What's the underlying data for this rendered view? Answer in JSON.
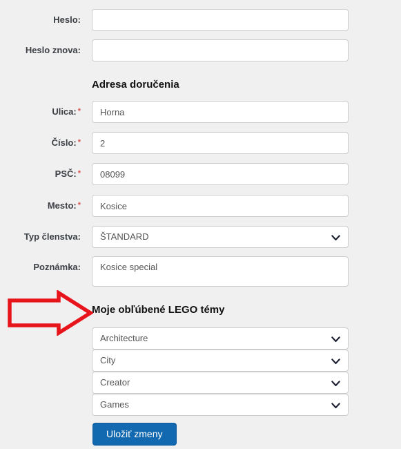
{
  "colors": {
    "page_background": "#f0f0f0",
    "field_border": "#cccccc",
    "field_background": "#ffffff",
    "label_text": "#3b3f44",
    "required_marker": "#d9534f",
    "primary_button": "#1269b0",
    "annotation_arrow": "#e8141c"
  },
  "form": {
    "account_fields": [
      {
        "label": "Heslo:",
        "required": false,
        "value": "",
        "placeholder": ""
      },
      {
        "label": "Heslo znova:",
        "required": false,
        "value": "",
        "placeholder": ""
      }
    ],
    "address_heading": "Adresa doručenia",
    "address_fields": [
      {
        "label": "Ulica:",
        "required": true,
        "value": "Horna",
        "placeholder": ""
      },
      {
        "label": "Číslo:",
        "required": true,
        "value": "2",
        "placeholder": ""
      },
      {
        "label": "PSČ:",
        "required": true,
        "value": "08099",
        "placeholder": ""
      },
      {
        "label": "Mesto:",
        "required": true,
        "value": "Kosice",
        "placeholder": ""
      }
    ],
    "membership": {
      "label": "Typ členstva:",
      "required": false,
      "value": "ŠTANDARD"
    },
    "note": {
      "label": "Poznámka:",
      "required": false,
      "value": "Kosice special",
      "placeholder": ""
    },
    "themes_heading": "Moje obľúbené LEGO témy",
    "themes": [
      {
        "value": "Architecture"
      },
      {
        "value": "City"
      },
      {
        "value": "Creator"
      },
      {
        "value": "Games"
      }
    ],
    "submit_label": "Uložiť zmeny"
  },
  "annotation": {
    "arrow_name": "red-right-arrow",
    "points_to": "Moje obľúbené LEGO témy"
  },
  "icons": {
    "chevron": "chevron-down-icon",
    "arrow": "arrow-right-icon"
  }
}
